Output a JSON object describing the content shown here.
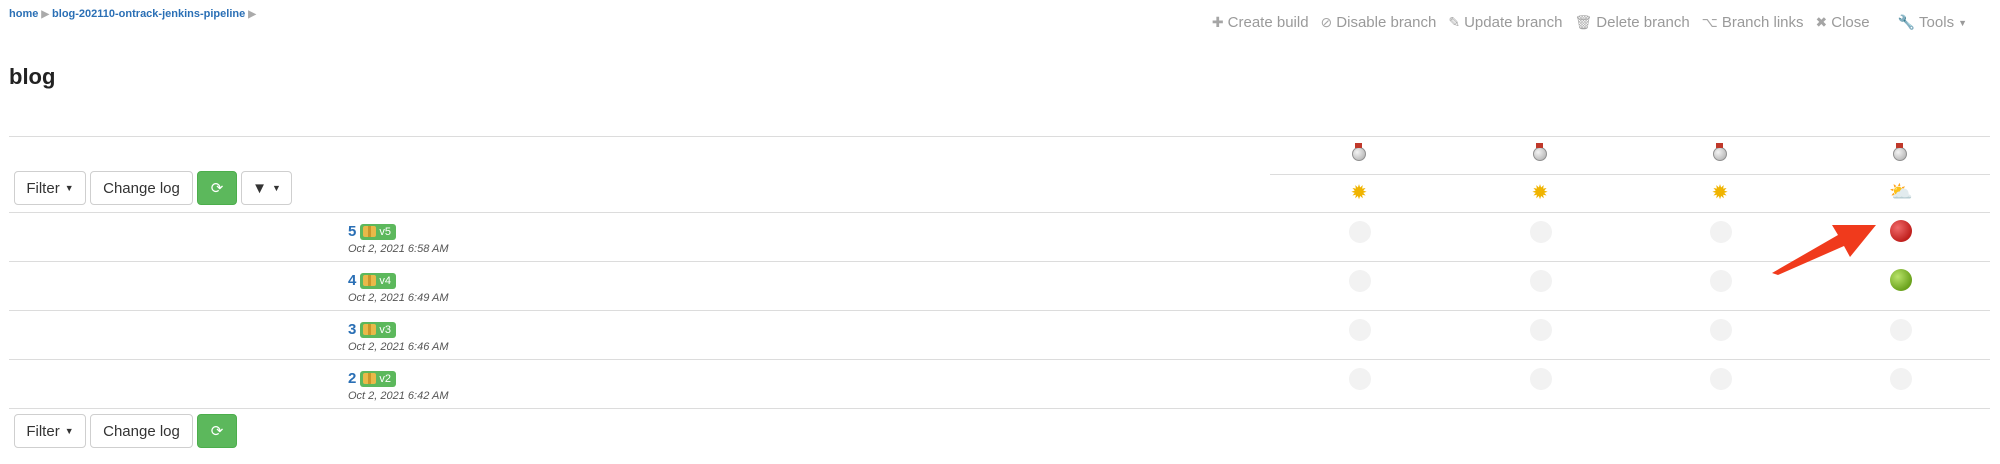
{
  "breadcrumb": {
    "home": "home",
    "project": "blog-202110-ontrack-jenkins-pipeline",
    "separator": "▶"
  },
  "actions": {
    "create_build": "Create build",
    "disable_branch": "Disable branch",
    "update_branch": "Update branch",
    "delete_branch": "Delete branch",
    "branch_links": "Branch links",
    "close": "Close",
    "tools": "Tools"
  },
  "page_title": "blog",
  "toolbar": {
    "filter_label": "Filter",
    "changelog_label": "Change log"
  },
  "validation_stamps": [
    {
      "weather": "sunny"
    },
    {
      "weather": "sunny"
    },
    {
      "weather": "sunny"
    },
    {
      "weather": "partly-cloudy"
    }
  ],
  "builds": [
    {
      "number": "5",
      "label": "v5",
      "date": "Oct 2, 2021 6:58 AM",
      "statuses": [
        "none",
        "none",
        "none",
        "failed"
      ]
    },
    {
      "number": "4",
      "label": "v4",
      "date": "Oct 2, 2021 6:49 AM",
      "statuses": [
        "none",
        "none",
        "none",
        "passed"
      ]
    },
    {
      "number": "3",
      "label": "v3",
      "date": "Oct 2, 2021 6:46 AM",
      "statuses": [
        "none",
        "none",
        "none",
        "none"
      ]
    },
    {
      "number": "2",
      "label": "v2",
      "date": "Oct 2, 2021 6:42 AM",
      "statuses": [
        "none",
        "none",
        "none",
        "none"
      ]
    }
  ],
  "colors": {
    "link": "#2a6fb5",
    "success": "#5cb85c",
    "failed": "#c0201d",
    "passed": "#6aa21c",
    "annotation_arrow": "#f03a1c"
  }
}
